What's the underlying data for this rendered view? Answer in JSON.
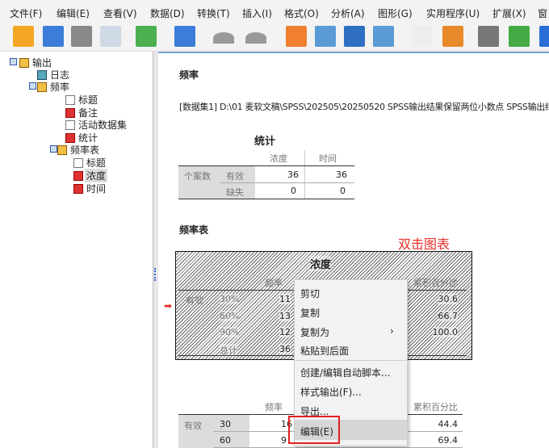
{
  "menu": [
    "文件(F)",
    "编辑(E)",
    "查看(V)",
    "数据(D)",
    "转换(T)",
    "插入(I)",
    "格式(O)",
    "分析(A)",
    "图形(G)",
    "实用程序(U)",
    "扩展(X)",
    "窗"
  ],
  "toolbar_icons": [
    "open-folder-icon",
    "save-icon",
    "print-icon",
    "print-preview-icon",
    "export-icon",
    "recall-dialog-icon",
    "undo-icon",
    "redo-icon",
    "goto-data-icon",
    "goto-case-icon",
    "insert-output-icon",
    "variables-icon",
    "script-icon",
    "run-script-icon",
    "hide-icon",
    "designate-window-icon",
    "search-icon"
  ],
  "tree": [
    {
      "label": "输出",
      "icon": "log-folder"
    },
    {
      "label": "日志",
      "icon": "log"
    },
    {
      "label": "频率",
      "icon": "folder"
    },
    {
      "label": "标题",
      "icon": "title"
    },
    {
      "label": "备注",
      "icon": "notes"
    },
    {
      "label": "活动数据集",
      "icon": "page"
    },
    {
      "label": "统计",
      "icon": "table"
    },
    {
      "label": "频率表",
      "icon": "folder"
    },
    {
      "label": "标题",
      "icon": "title"
    },
    {
      "label": "浓度",
      "icon": "table",
      "selected": true
    },
    {
      "label": "时间",
      "icon": "table"
    }
  ],
  "content": {
    "heading": "频率",
    "dataset_line": "[数据集1] D:\\01 麦软文稿\\SPSS\\202505\\20250520 SPSS输出结果保留两位小数点 SPSS输出结",
    "stats": {
      "title": "统计",
      "cols": [
        "浓度",
        "时间"
      ],
      "group": "个案数",
      "rows": [
        {
          "label": "有效",
          "values": [
            "36",
            "36"
          ]
        },
        {
          "label": "缺失",
          "values": [
            "0",
            "0"
          ]
        }
      ]
    },
    "freq_heading": "频率表",
    "annotation": "双击图表",
    "annotation_color": "#e8302a",
    "table1": {
      "title": "浓度",
      "col_freq": "频率",
      "col_cum": "累积百分比",
      "group": "有效",
      "rows": [
        {
          "label": "30%",
          "freq": "11",
          "cum": "30.6"
        },
        {
          "label": "60%",
          "freq": "13",
          "cum": "66.7"
        },
        {
          "label": "90%",
          "freq": "12",
          "cum": "100.0"
        },
        {
          "label": "总计",
          "freq": "36",
          "cum": ""
        }
      ]
    },
    "table2": {
      "col_freq": "频率",
      "col_cum": "累积百分比",
      "group": "有效",
      "rows": [
        {
          "label": "30",
          "freq": "16",
          "cum": "44.4"
        },
        {
          "label": "60",
          "freq": "9",
          "cum": "69.4"
        }
      ]
    }
  },
  "context_menu": {
    "items": [
      "剪切",
      "复制",
      "复制为",
      "粘贴到后面",
      "创建/编辑自动脚本...",
      "样式输出(F)...",
      "导出...",
      "编辑(E)"
    ],
    "submenu_arrow": "›",
    "highlighted": "编辑(E)"
  }
}
